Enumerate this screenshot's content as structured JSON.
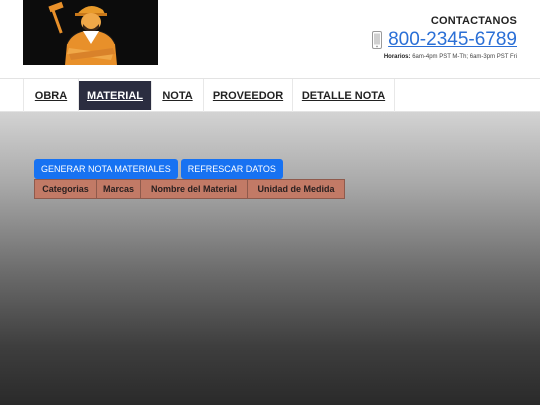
{
  "header": {
    "contact_label": "CONTACTANOS",
    "phone": "800-2345-6789",
    "hours_label": "Horarios:",
    "hours_text": "6am-4pm PST M-Th; 6am-3pm PST Fri"
  },
  "nav": {
    "items": [
      {
        "label": "OBRA"
      },
      {
        "label": "MATERIAL"
      },
      {
        "label": "NOTA"
      },
      {
        "label": "PROVEEDOR"
      },
      {
        "label": "DETALLE NOTA"
      }
    ],
    "active": "MATERIAL"
  },
  "actions": {
    "generate_label": "GENERAR NOTA MATERIALES",
    "refresh_label": "REFRESCAR DATOS"
  },
  "table": {
    "columns": [
      "Categorias",
      "Marcas",
      "Nombre del Material",
      "Unidad de Medida"
    ]
  },
  "colors": {
    "accent": "#1772f2",
    "nav_active": "#2b2d40",
    "table_header": "#c27a66",
    "phone_link": "#2a6fd6"
  }
}
